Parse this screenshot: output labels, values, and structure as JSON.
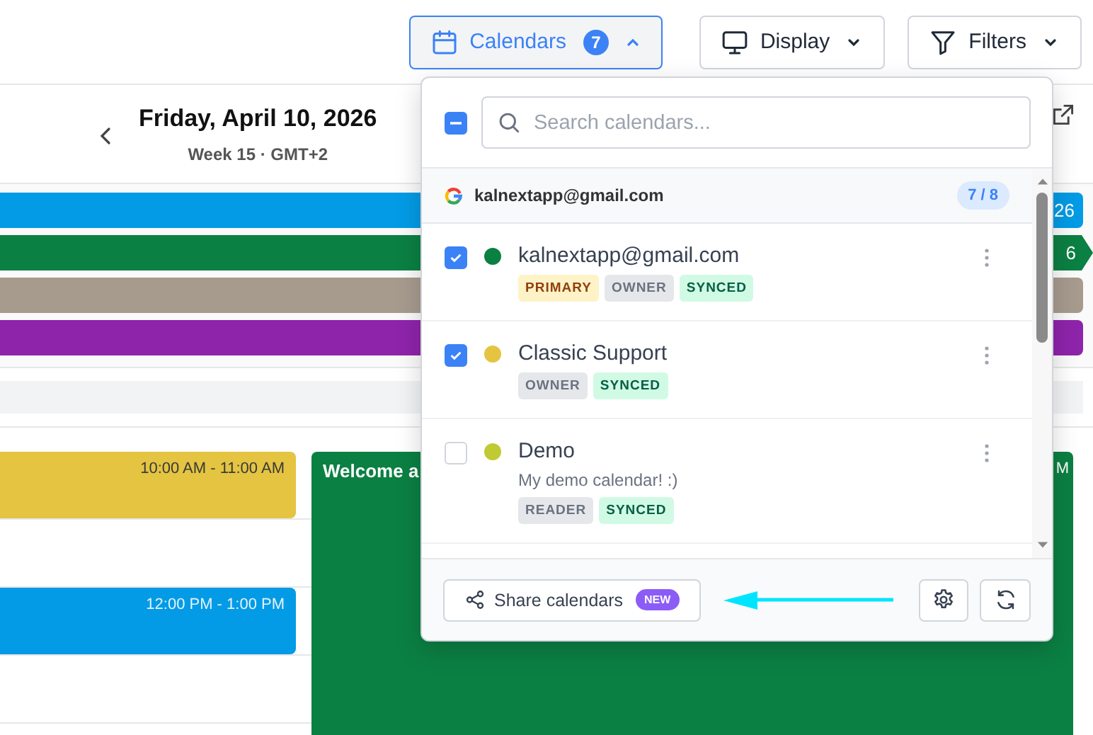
{
  "toolbar": {
    "buttons": [
      {
        "kind": "calendars",
        "label": "Calendars",
        "count": "7",
        "expanded": true
      },
      {
        "kind": "display",
        "label": "Display",
        "expanded": false
      },
      {
        "kind": "filters",
        "label": "Filters",
        "expanded": false
      }
    ]
  },
  "day_header": {
    "title": "Friday, April 10, 2026",
    "subtitle": "Week 15 · GMT+2"
  },
  "all_day_events": [
    {
      "color": "#039be5",
      "text": "26",
      "continues": false
    },
    {
      "color": "#0b8043",
      "text": "6",
      "continues": true
    },
    {
      "color": "#a79b8e",
      "continues": false
    },
    {
      "color": "#8e24aa",
      "continues": false
    }
  ],
  "events": [
    {
      "time": "10:00 AM - 11:00 AM",
      "color": "#e4c441",
      "kind": "dark_text"
    },
    {
      "time": "12:00 PM - 1:00 PM",
      "color": "#039be5",
      "kind": "light_text"
    }
  ],
  "featured_event": {
    "title": "Welcome a",
    "time": "M",
    "color": "#0b8043"
  },
  "calendar_menu": {
    "select_all": {
      "indeterminate": true
    },
    "search": {
      "placeholder": "Search calendars..."
    },
    "account": {
      "email": "kalnextapp@gmail.com",
      "count": "7 / 8"
    },
    "calendars": [
      {
        "name": "kalnextapp@gmail.com",
        "color": "#0b8043",
        "checked": true,
        "tags": [
          {
            "label": "PRIMARY",
            "kind": "primary"
          },
          {
            "label": "OWNER",
            "kind": "role"
          },
          {
            "label": "SYNCED",
            "kind": "synced"
          }
        ]
      },
      {
        "name": "Classic Support",
        "color": "#e4c441",
        "checked": true,
        "tags": [
          {
            "label": "OWNER",
            "kind": "role"
          },
          {
            "label": "SYNCED",
            "kind": "synced"
          }
        ]
      },
      {
        "name": "Demo",
        "color": "#c0ca33",
        "checked": false,
        "description": "My demo calendar! :)",
        "tags": [
          {
            "label": "READER",
            "kind": "role"
          },
          {
            "label": "SYNCED",
            "kind": "synced"
          }
        ]
      }
    ],
    "share_button": {
      "label": "Share calendars",
      "badge": "NEW"
    }
  }
}
